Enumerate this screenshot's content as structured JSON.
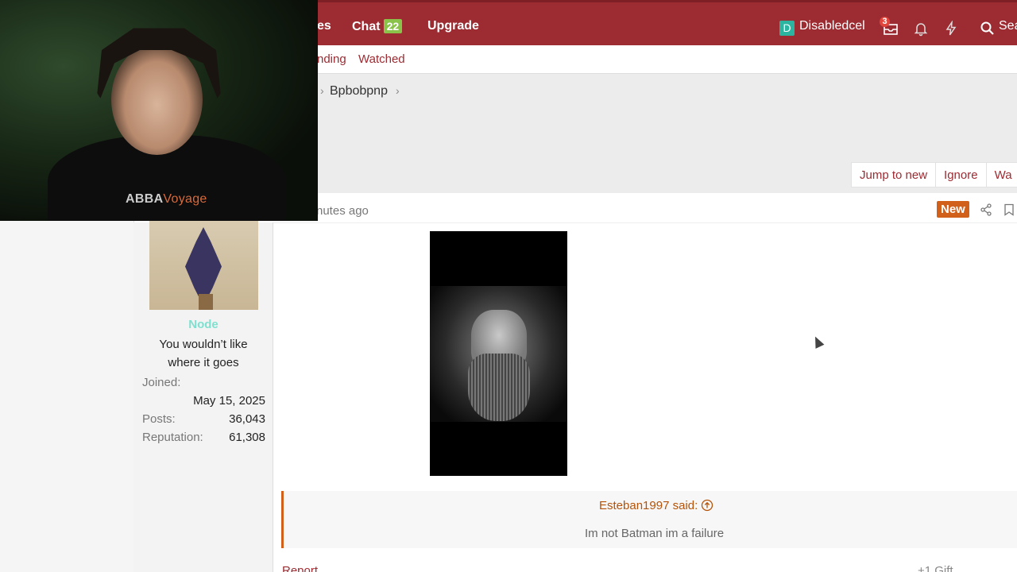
{
  "topnav": {
    "partial_item": "es",
    "chat_label": "Chat",
    "chat_count": "22",
    "upgrade_label": "Upgrade",
    "user_initial": "D",
    "username": "Disabledcel",
    "inbox_count": "3",
    "search_label": "Sea"
  },
  "subnav": {
    "partial_link": "nding",
    "watched": "Watched"
  },
  "breadcrumb": {
    "current": "Bpbobpnp"
  },
  "thread_buttons": [
    "Jump to new",
    "Ignore",
    "Wa"
  ],
  "post": {
    "time_partial": "nutes ago",
    "new_label": "New",
    "author": {
      "name": "Node",
      "title": "You wouldn’t like where it goes",
      "joined_label": "Joined:",
      "joined_value": "May 15, 2025",
      "posts_label": "Posts:",
      "posts_value": "36,043",
      "reputation_label": "Reputation:",
      "reputation_value": "61,308"
    },
    "quote": {
      "author": "Esteban1997 said:",
      "text": "Im not Batman im a failure"
    },
    "report_label": "Report",
    "footer_right": "+1   Gift"
  },
  "webcam": {
    "shirt_text_a": "ABBA",
    "shirt_text_b": "Voyage"
  },
  "colors": {
    "brand": "#9c2b32",
    "new_badge": "#d0601a",
    "chat_badge": "#8bc34a",
    "username": "#7fe0cf"
  }
}
